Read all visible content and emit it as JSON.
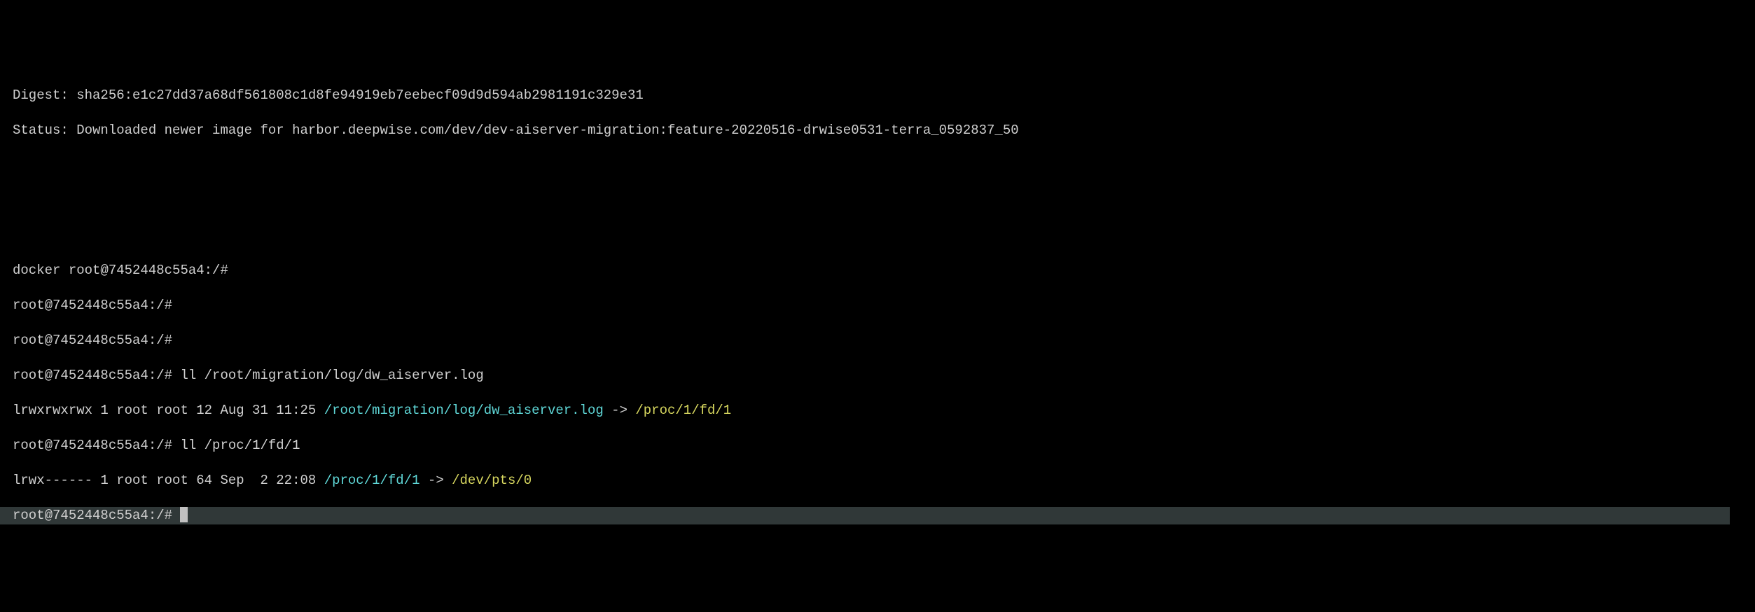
{
  "terminal": {
    "digest_label": "Digest: ",
    "digest_value": "sha256:e1c27dd37a68df561808c1d8fe94919eb7eebecf09d9d594ab2981191c329e31",
    "status_label": "Status: ",
    "status_value": "Downloaded newer image for harbor.deepwise.com/dev/dev-aiserver-migration:feature-20220516-drwise0531-terra_0592837_50",
    "docker_prompt": "docker root@7452448c55a4:/#",
    "prompt": "root@7452448c55a4:/#",
    "cmd1": " ll /root/migration/log/dw_aiserver.log",
    "ls1_perm": "lrwxrwxrwx 1 root root 12 Aug 31 11:25 ",
    "ls1_path": "/root/migration/log/dw_aiserver.log",
    "ls1_arrow": " -> ",
    "ls1_target": "/proc/1/fd/1",
    "cmd2": " ll /proc/1/fd/1",
    "ls2_perm": "lrwx------ 1 root root 64 Sep  2 22:08 ",
    "ls2_path": "/proc/1/fd/1",
    "ls2_arrow": " -> ",
    "ls2_target": "/dev/pts/0",
    "final_prompt": "root@7452448c55a4:/# "
  }
}
